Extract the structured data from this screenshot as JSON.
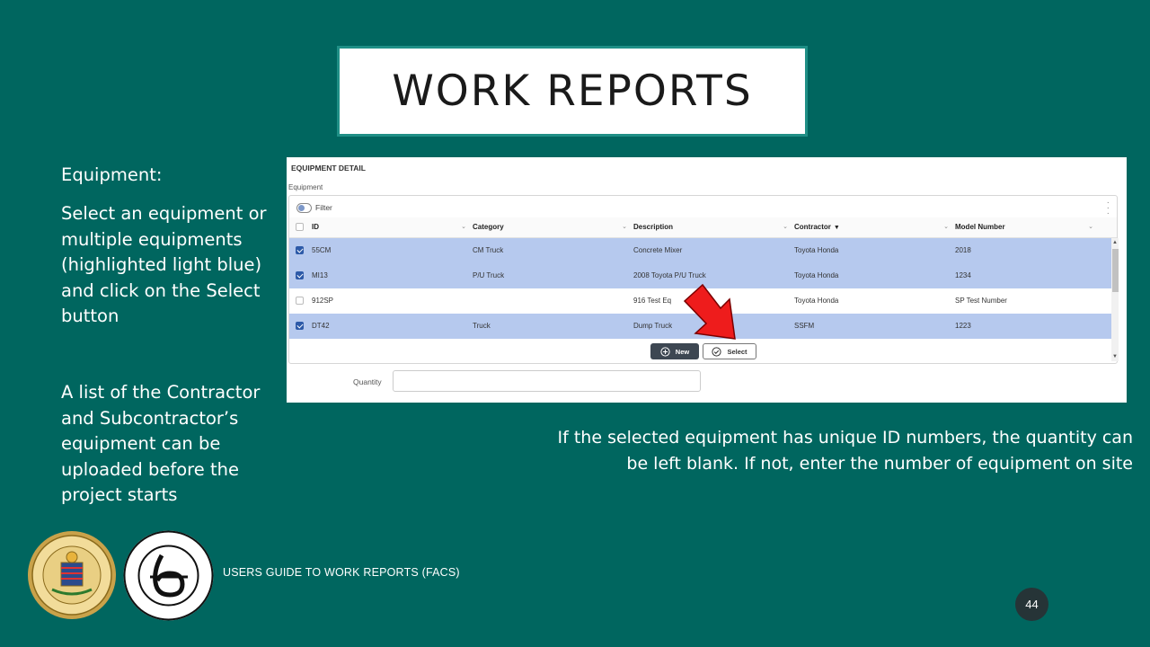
{
  "slide": {
    "title": "WORK REPORTS",
    "equipment_heading": "Equipment:",
    "instruction": "Select an equipment or multiple equipments (highlighted light blue) and click on the Select button",
    "list_note": "A list of the Contractor and Subcontractor’s equipment can be uploaded before the project starts",
    "quantity_note_line1": "If the selected equipment has unique ID numbers, the quantity can",
    "quantity_note_line2": "be left blank.  If not, enter the number of equipment on site",
    "footer": "USERS GUIDE TO WORK REPORTS  (FACS)",
    "page_number": "44"
  },
  "panel": {
    "title": "EQUIPMENT DETAIL",
    "subtitle": "Equipment",
    "filter_label": "Filter",
    "columns": [
      "ID",
      "Category",
      "Description",
      "Contractor",
      "Model Number"
    ],
    "rows": [
      {
        "id": "55CM",
        "category": "CM Truck",
        "description": "Concrete Mixer",
        "contractor": "Toyota Honda",
        "model": "2018",
        "selected": true
      },
      {
        "id": "MI13",
        "category": "P/U Truck",
        "description": "2008 Toyota P/U Truck",
        "contractor": "Toyota Honda",
        "model": "1234",
        "selected": true
      },
      {
        "id": "912SP",
        "category": "",
        "description": "916 Test Eq",
        "contractor": "Toyota Honda",
        "model": "SP Test Number",
        "selected": false
      },
      {
        "id": "DT42",
        "category": "Truck",
        "description": "Dump Truck",
        "contractor": "SSFM",
        "model": "1223",
        "selected": true
      }
    ],
    "new_label": "New",
    "select_label": "Select",
    "quantity_label": "Quantity",
    "quantity_value": ""
  },
  "colors": {
    "background": "#00665f",
    "selected_row": "#b6c9ee",
    "checkbox": "#2d5aa8",
    "arrow": "#ee1c1c"
  },
  "icons": {
    "filter": "toggle-icon",
    "menu": "kebab-icon",
    "new": "plus-circle-icon",
    "select": "check-circle-icon",
    "pointer": "red-arrow-icon"
  }
}
